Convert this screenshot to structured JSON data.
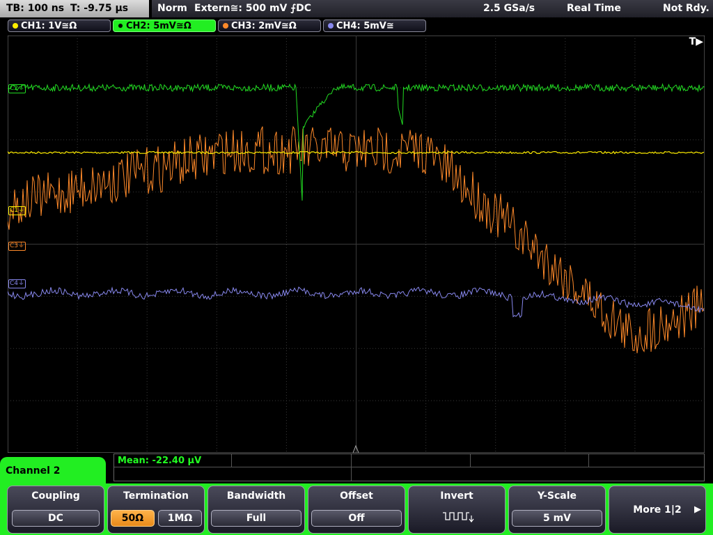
{
  "status": {
    "timebase": "TB: 100 ns",
    "trigger_time": "T: -9.75 µs",
    "trigger_mode": "Norm",
    "trigger_source": "Extern≅: 500 mV ⨍DC",
    "sample_rate": "2.5 GSa/s",
    "acq_mode": "Real Time",
    "run_state": "Not Rdy."
  },
  "channels": [
    {
      "id": "ch1",
      "label": "CH1: 1V≅Ω",
      "color": "#ffee00",
      "marker": "C1"
    },
    {
      "id": "ch2",
      "label": "CH2: 5mV≅Ω",
      "color": "#22dd22",
      "marker": "C2"
    },
    {
      "id": "ch3",
      "label": "CH3: 2mV≅Ω",
      "color": "#ff8a2a",
      "marker": "C3"
    },
    {
      "id": "ch4",
      "label": "CH4: 5mV≅",
      "color": "#8888ee",
      "marker": "C4"
    }
  ],
  "trigger_marker": "T▶",
  "measurement": "Mean: -22.40 µV",
  "menu": {
    "title": "Channel 2",
    "coupling": {
      "label": "Coupling",
      "value": "DC"
    },
    "termination": {
      "label": "Termination",
      "options": [
        "50Ω",
        "1MΩ"
      ],
      "selected": "50Ω"
    },
    "bandwidth": {
      "label": "Bandwidth",
      "value": "Full"
    },
    "offset": {
      "label": "Offset",
      "value": "Off"
    },
    "invert": {
      "label": "Invert"
    },
    "yscale": {
      "label": "Y-Scale",
      "value": "5 mV"
    },
    "more": {
      "label": "More 1|2"
    }
  }
}
